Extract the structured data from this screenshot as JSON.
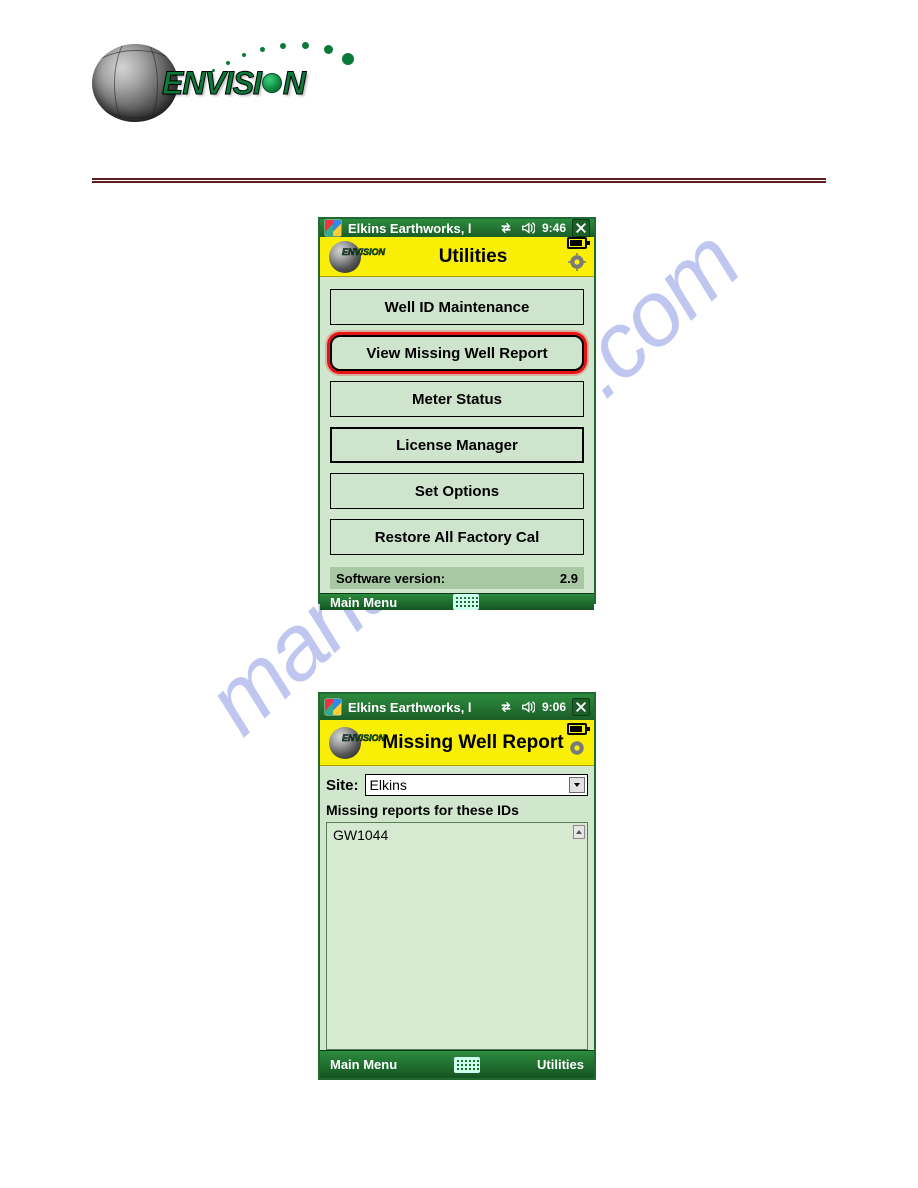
{
  "logo": {
    "text_left": "ENVISI",
    "text_right": "N"
  },
  "watermark": "manualshive.com",
  "screen_a": {
    "titlebar": "Elkins Earthworks, l",
    "time": "9:46",
    "app_title": "Utilities",
    "buttons": [
      "Well ID Maintenance",
      "View Missing Well Report",
      "Meter Status",
      "License Manager",
      "Set Options",
      "Restore All Factory Cal"
    ],
    "highlight_index": 1,
    "version_label": "Software version:",
    "version_value": "2.9",
    "menu_left": "Main Menu"
  },
  "screen_b": {
    "titlebar": "Elkins Earthworks, l",
    "time": "9:06",
    "app_title": "Missing Well Report",
    "site_label": "Site:",
    "site_value": "Elkins",
    "subhead": "Missing reports for these IDs",
    "items": [
      "GW1044"
    ],
    "menu_left": "Main Menu",
    "menu_right": "Utilities"
  }
}
